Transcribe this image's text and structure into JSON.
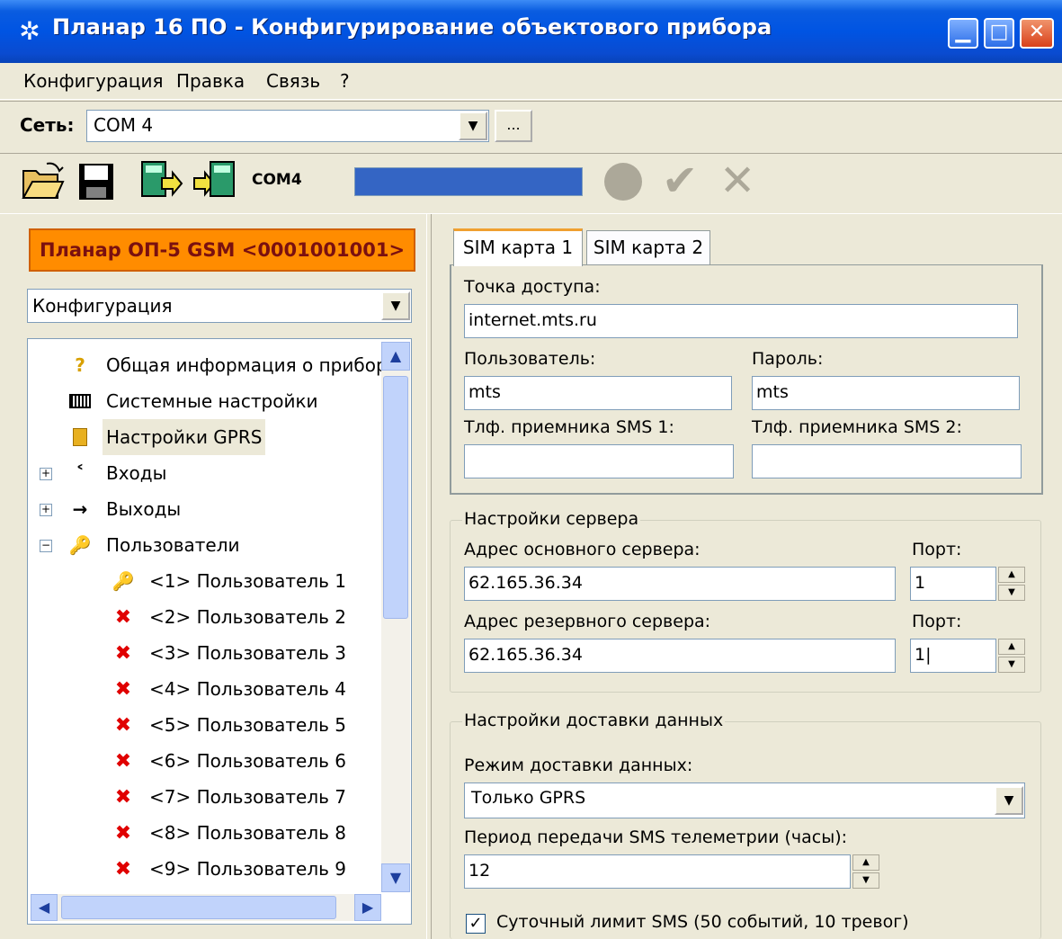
{
  "window": {
    "title": "Планар 16 ПО - Конфигурирование объектового прибора",
    "icon": "gear-icon",
    "controls": [
      "minimize-icon",
      "maximize-icon",
      "close-icon"
    ]
  },
  "menu": {
    "items": [
      "Конфигурация",
      "Правка",
      "Связь",
      "?"
    ]
  },
  "network": {
    "label": "Сеть:",
    "value": "COM 4",
    "more_label": "..."
  },
  "toolbar": {
    "icons": [
      "open-folder-icon",
      "save-icon",
      "read-device-icon",
      "write-device-icon"
    ],
    "port_label": "COM4",
    "progress": 1.0,
    "status_icons": [
      "status-led-icon",
      "apply-check-icon",
      "cancel-cross-icon"
    ]
  },
  "left": {
    "device_title": "Планар ОП-5 GSM <0001001001>",
    "config_select": "Конфигурация",
    "tree": [
      {
        "label": "Общая информация о прибор",
        "icon": "question-icon",
        "level": 0
      },
      {
        "label": "Системные настройки",
        "icon": "keyboard-icon",
        "level": 0
      },
      {
        "label": "Настройки GPRS",
        "icon": "sim-chip-icon",
        "level": 0,
        "selected": true
      },
      {
        "label": "Входы",
        "icon": "input-arrow-icon",
        "level": 0,
        "expander": "+"
      },
      {
        "label": "Выходы",
        "icon": "output-arrow-icon",
        "level": 0,
        "expander": "+"
      },
      {
        "label": "Пользователи",
        "icon": "keys-icon",
        "level": 0,
        "expander": "−"
      },
      {
        "label": "<1> Пользователь 1",
        "icon": "key-icon",
        "level": 1
      },
      {
        "label": "<2> Пользователь 2",
        "icon": "key-disabled-icon",
        "level": 1
      },
      {
        "label": "<3> Пользователь 3",
        "icon": "key-disabled-icon",
        "level": 1
      },
      {
        "label": "<4> Пользователь 4",
        "icon": "key-disabled-icon",
        "level": 1
      },
      {
        "label": "<5> Пользователь 5",
        "icon": "key-disabled-icon",
        "level": 1
      },
      {
        "label": "<6> Пользователь 6",
        "icon": "key-disabled-icon",
        "level": 1
      },
      {
        "label": "<7> Пользователь 7",
        "icon": "key-disabled-icon",
        "level": 1
      },
      {
        "label": "<8> Пользователь 8",
        "icon": "key-disabled-icon",
        "level": 1
      },
      {
        "label": "<9> Пользователь 9",
        "icon": "key-disabled-icon",
        "level": 1
      }
    ]
  },
  "right": {
    "tabs": [
      "SIM карта 1",
      "SIM карта 2"
    ],
    "sim": {
      "apn_label": "Точка доступа:",
      "apn_value": "internet.mts.ru",
      "user_label": "Пользователь:",
      "user_value": "mts",
      "password_label": "Пароль:",
      "password_value": "mts",
      "sms1_label": "Тлф. приемника SMS 1:",
      "sms1_value": "",
      "sms2_label": "Тлф. приемника SMS 2:",
      "sms2_value": ""
    },
    "server": {
      "title": "Настройки сервера",
      "main_label": "Адрес основного сервера:",
      "main_value": "62.165.36.34",
      "main_port_label": "Порт:",
      "main_port_value": "1",
      "backup_label": "Адрес резервного сервера:",
      "backup_value": "62.165.36.34",
      "backup_port_label": "Порт:",
      "backup_port_value": "1|"
    },
    "delivery": {
      "title": "Настройки доставки данных",
      "mode_label": "Режим доставки данных:",
      "mode_value": "Только GPRS",
      "period_label": "Период передачи SMS телеметрии (часы):",
      "period_value": "12",
      "limit_label": "Суточный лимит SMS (50 событий, 10 тревог)",
      "limit_checked": true
    }
  },
  "colors": {
    "titlebar": "#0054e3",
    "device_title_bg": "#ff8c00",
    "progress": "#3465c4",
    "window_bg": "#ece9d8"
  }
}
